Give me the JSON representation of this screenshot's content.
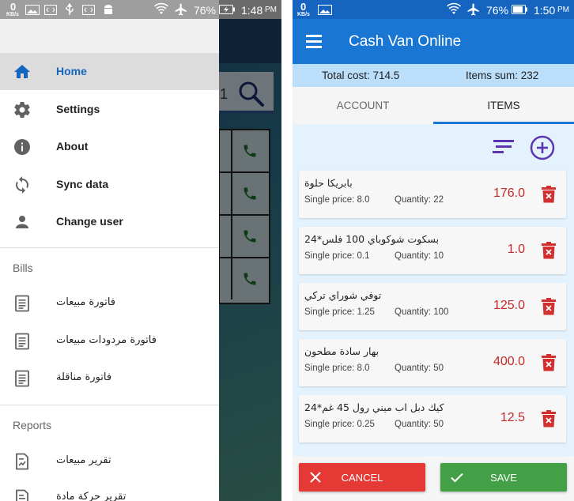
{
  "left_screen": {
    "status_bar": {
      "data_speed": "0",
      "data_unit": "KB/s",
      "battery": "76%",
      "time": "1:48",
      "ampm": "PM"
    },
    "background_peek": {
      "search_text": "1"
    },
    "drawer": {
      "items": [
        {
          "label": "Home",
          "icon": "home-icon"
        },
        {
          "label": "Settings",
          "icon": "gear-icon"
        },
        {
          "label": "About",
          "icon": "info-icon"
        },
        {
          "label": "Sync data",
          "icon": "sync-icon"
        },
        {
          "label": "Change user",
          "icon": "person-icon"
        }
      ],
      "bills_header": "Bills",
      "bills": [
        {
          "label": "فاتورة مبيعات"
        },
        {
          "label": "فاتورة مردودات مبيعات"
        },
        {
          "label": "فاتورة مناقلة"
        }
      ],
      "reports_header": "Reports",
      "reports": [
        {
          "label": "تقرير مبيعات"
        },
        {
          "label": "تقرير حركة مادة"
        }
      ]
    }
  },
  "right_screen": {
    "status_bar": {
      "data_speed": "0",
      "data_unit": "KB/s",
      "battery": "76%",
      "time": "1:50",
      "ampm": "PM"
    },
    "app_title": "Cash Van Online",
    "summary": {
      "total_cost": "Total cost: 714.5",
      "items_sum": "Items sum: 232"
    },
    "tabs": [
      {
        "label": "ACCOUNT"
      },
      {
        "label": "ITEMS"
      }
    ],
    "active_tab": "ITEMS",
    "items": [
      {
        "name": "بابريكا حلوة",
        "single_price": "Single price: 8.0",
        "quantity": "Quantity: 22",
        "total": "176.0"
      },
      {
        "name": "بسكوت شوكوباي 100 فلس*24",
        "single_price": "Single price: 0.1",
        "quantity": "Quantity: 10",
        "total": "1.0"
      },
      {
        "name": "توفي شوراي تركي",
        "single_price": "Single price: 1.25",
        "quantity": "Quantity: 100",
        "total": "125.0"
      },
      {
        "name": "بهار سادة مطحون",
        "single_price": "Single price: 8.0",
        "quantity": "Quantity: 50",
        "total": "400.0"
      },
      {
        "name": "كيك دبل اب ميني رول 45 غم*24",
        "single_price": "Single price: 0.25",
        "quantity": "Quantity: 50",
        "total": "12.5"
      }
    ],
    "actions": {
      "cancel": "CANCEL",
      "save": "SAVE"
    },
    "colors": {
      "primary": "#1976d2",
      "primary_dark": "#1565c0",
      "accent": "#5e35b1",
      "price_red": "#c62828",
      "cancel_red": "#e53935",
      "save_green": "#43a047"
    }
  }
}
